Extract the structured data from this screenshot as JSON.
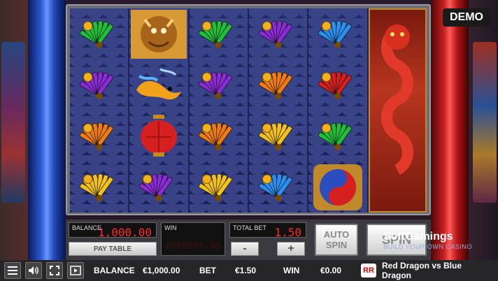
{
  "demo_label": "DEMO",
  "reels": [
    [
      "fan-green",
      "fan-purple",
      "fan-orange",
      "fan-yellow"
    ],
    [
      "golden-dragon",
      "koi-fish",
      "red-lantern",
      "fan-purple"
    ],
    [
      "fan-green",
      "fan-purple",
      "fan-orange",
      "fan-yellow"
    ],
    [
      "fan-purple",
      "fan-orange",
      "fan-yellow",
      "fan-blue"
    ],
    [
      "fan-blue",
      "fan-red",
      "fan-green",
      "yin-yang"
    ],
    [
      "red-dragon-wild"
    ]
  ],
  "colors": {
    "fan-green": "#1fbf3a",
    "fan-purple": "#8a2bd6",
    "fan-orange": "#f07a12",
    "fan-yellow": "#f2c21a",
    "fan-blue": "#2a8ff0",
    "fan-red": "#d81f1f"
  },
  "panel": {
    "balance_label": "BALANCE",
    "balance_value": "1,000.00",
    "paytable_label": "PAY TABLE",
    "win_label": "WIN",
    "win_display": "8888888.88",
    "totalbet_label": "TOTAL BET",
    "totalbet_value": "1.50",
    "minus_label": "-",
    "plus_label": "+",
    "autospin_label": "AUTO SPIN",
    "spin_label": "SPIN"
  },
  "bottom_bar": {
    "balance_label": "BALANCE",
    "balance_value": "€1,000.00",
    "bet_label": "BET",
    "bet_value": "€1.50",
    "win_label": "WIN",
    "win_value": "€0.00",
    "rr_logo": "RR",
    "game_title": "Red Dragon vs Blue Dragon",
    "icons": [
      "menu-icon",
      "sound-icon",
      "fullscreen-icon",
      "video-icon"
    ]
  },
  "watermark": {
    "brand": "SoftGamings",
    "tagline": "BUILD YOUR OWN CASINO"
  }
}
